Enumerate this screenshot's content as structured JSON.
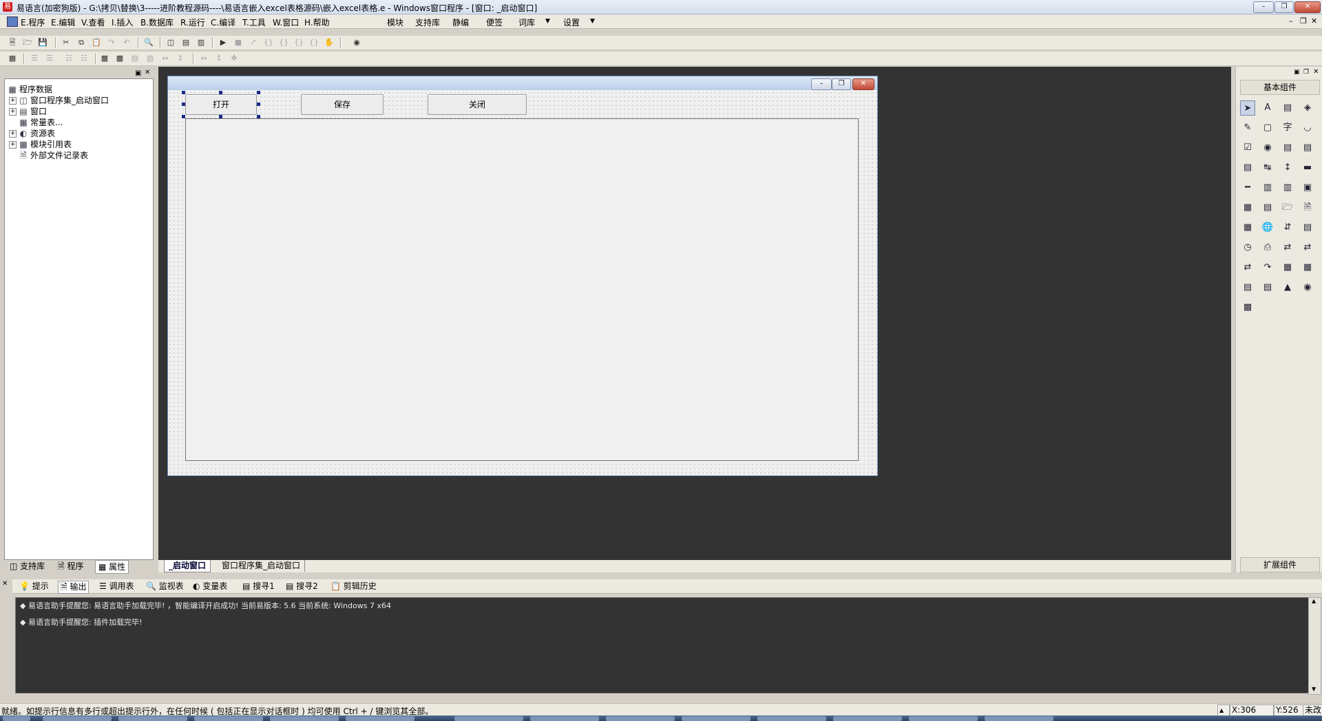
{
  "window": {
    "app_icon": "app-logo-icon",
    "title": "易语言(加密狗版) - G:\\拷贝\\替换\\3-----进阶教程源码----\\易语言嵌入excel表格源码\\嵌入excel表格.e - Windows窗口程序 - [窗口: _启动窗口]"
  },
  "menu": {
    "items": [
      "E.程序",
      "E.编辑",
      "V.查看",
      "I.插入",
      "B.数据库",
      "R.运行",
      "C.编译",
      "T.工具",
      "W.窗口",
      "H.帮助"
    ],
    "extras": [
      "模块",
      "支持库",
      "静编",
      "便签",
      "词库",
      "设置"
    ]
  },
  "left_panel": {
    "root": "程序数据",
    "items": [
      {
        "label": "窗口程序集_启动窗口",
        "expand": "+",
        "icon": "assembly-icon"
      },
      {
        "label": "窗口",
        "expand": "+",
        "icon": "window-icon"
      },
      {
        "label": "常量表...",
        "expand": "",
        "icon": "constant-table-icon"
      },
      {
        "label": "资源表",
        "expand": "+",
        "icon": "resource-icon"
      },
      {
        "label": "模块引用表",
        "expand": "+",
        "icon": "module-ref-icon"
      },
      {
        "label": "外部文件记录表",
        "expand": "",
        "icon": "external-file-icon"
      }
    ],
    "tabs": [
      "支持库",
      "程序",
      "属性"
    ]
  },
  "form": {
    "buttons": [
      "打开",
      "保存",
      "关闭"
    ]
  },
  "design_tabs": [
    "_启动窗口",
    "窗口程序集_启动窗口"
  ],
  "right_panel": {
    "header": "基本组件",
    "footer": "扩展组件"
  },
  "output_tabs": [
    "提示",
    "输出",
    "调用表",
    "监视表",
    "变量表",
    "搜寻1",
    "搜寻2",
    "剪辑历史"
  ],
  "output_lines": [
    "◆ 易语言助手提醒您: 易语言助手加载完毕! ，智能编译开启成功! 当前易版本: 5.6 当前系统: Windows 7 x64",
    "◆ 易语言助手提醒您: 插件加载完毕!"
  ],
  "status": {
    "text": "就绪。如提示行信息有多行或超出提示行外，在任何时候 ( 包括正在显示对话框时 ) 均可使用 Ctrl + / 键浏览其全部。",
    "x": "X:306",
    "y": "Y:526",
    "mode": "未改"
  }
}
